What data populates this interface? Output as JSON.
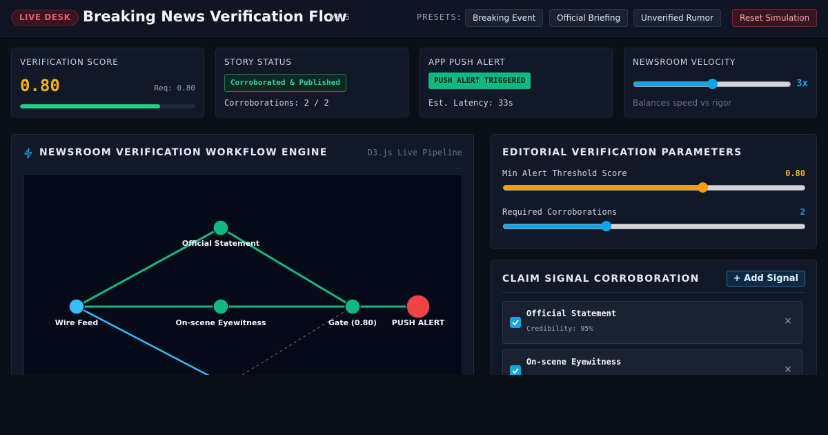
{
  "header": {
    "badge": "LIVE DESK",
    "title": "Breaking News Verification Flow",
    "version": "v3.5",
    "presets_label": "PRESETS:",
    "presets": [
      "Breaking Event",
      "Official Briefing",
      "Unverified Rumor"
    ],
    "reset_label": "Reset Simulation"
  },
  "stats": {
    "score": {
      "label": "Verification Score",
      "value": "0.80",
      "required": "Req: 0.80",
      "progress": 0.8
    },
    "status": {
      "label": "Story Status",
      "pill": "Corroborated & Published",
      "detail": "Corroborations: 2 / 2"
    },
    "alert": {
      "label": "App Push Alert",
      "pill": "PUSH ALERT TRIGGERED",
      "detail": "Est. Latency: 33s"
    },
    "velocity": {
      "label": "Newsroom Velocity",
      "value": "3x",
      "slider_fraction": 0.5,
      "caption": "Balances speed vs rigor"
    }
  },
  "workflow": {
    "title": "Newsroom Verification Workflow Engine",
    "tag": "D3.js Live Pipeline",
    "nodes": [
      {
        "id": "wire",
        "label": "Wire Feed"
      },
      {
        "id": "official",
        "label": "Official Statement"
      },
      {
        "id": "eyewitness",
        "label": "On-scene Eyewitness"
      },
      {
        "id": "gate",
        "label": "Gate (0.80)"
      },
      {
        "id": "alert",
        "label": "PUSH ALERT"
      }
    ]
  },
  "params": {
    "title": "Editorial Verification Parameters",
    "threshold": {
      "label": "Min Alert Threshold Score",
      "value": "0.80",
      "fraction": 0.66
    },
    "corroborations": {
      "label": "Required Corroborations",
      "value": "2",
      "fraction": 0.34
    }
  },
  "signals": {
    "title": "Claim Signal Corroboration",
    "add_label": "+ Add Signal",
    "items": [
      {
        "name": "Official Statement",
        "credibility": "Credibility: 95%",
        "checked": true
      },
      {
        "name": "On-scene Eyewitness",
        "credibility": "",
        "checked": true
      }
    ],
    "remove_glyph": "×"
  },
  "colors": {
    "accent_amber": "#f5b416",
    "accent_green": "#10b981",
    "accent_blue": "#0ea5e9",
    "alert_red": "#ef4444"
  }
}
